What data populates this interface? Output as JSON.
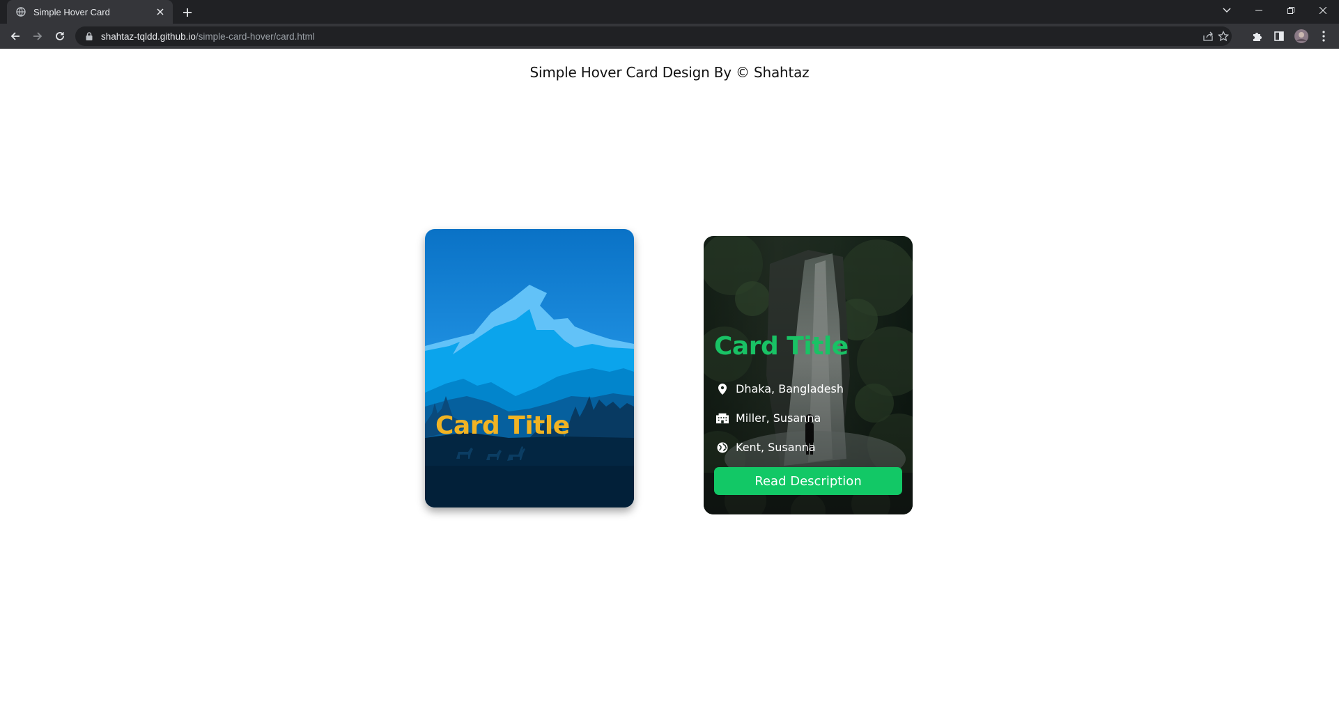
{
  "browser": {
    "tab_title": "Simple Hover Card",
    "url_host": "shahtaz-tqldd.github.io",
    "url_path": "/simple-card-hover/card.html"
  },
  "page": {
    "heading": "Simple Hover Card Design By © Shahtaz"
  },
  "cards": [
    {
      "title": "Card Title",
      "title_color": "#f1b323"
    },
    {
      "title": "Card Title",
      "title_color": "#19c265",
      "details": [
        {
          "icon": "location-pin-icon",
          "text": "Dhaka, Bangladesh"
        },
        {
          "icon": "building-icon",
          "text": "Miller, Susanna"
        },
        {
          "icon": "globe-icon",
          "text": "Kent, Susanna"
        }
      ],
      "button_label": "Read Description",
      "button_color": "#12c866"
    }
  ]
}
